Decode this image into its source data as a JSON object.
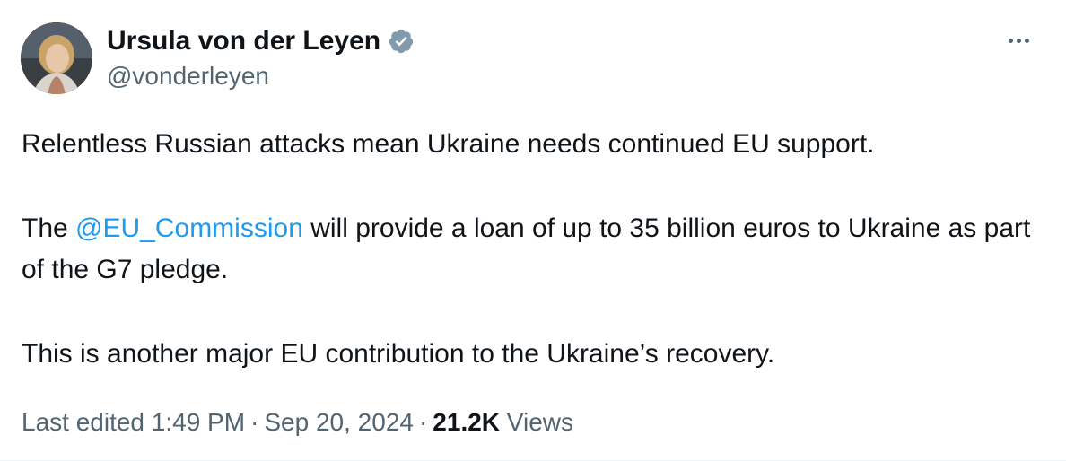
{
  "author": {
    "name": "Ursula von der Leyen",
    "handle": "@vonderleyen",
    "verified_icon": "verified-badge-icon",
    "verified_color": "#829aab"
  },
  "menu": {
    "icon": "more-options-icon"
  },
  "tweet": {
    "line1": "Relentless Russian attacks mean Ukraine needs continued EU support.",
    "para2_prefix": "The ",
    "para2_mention": "@EU_Commission",
    "para2_suffix": " will provide a loan of up to 35 billion euros to Ukraine as part of the G7 pledge.",
    "line3": "This is another major EU contribution to the Ukraine’s recovery."
  },
  "meta": {
    "edited_label": "Last edited 1:49 PM",
    "separator": "·",
    "date": "Sep 20, 2024",
    "views_count": "21.2K",
    "views_label": "Views"
  },
  "colors": {
    "text": "#0f1419",
    "secondary": "#536471",
    "link": "#1d9bf0"
  }
}
